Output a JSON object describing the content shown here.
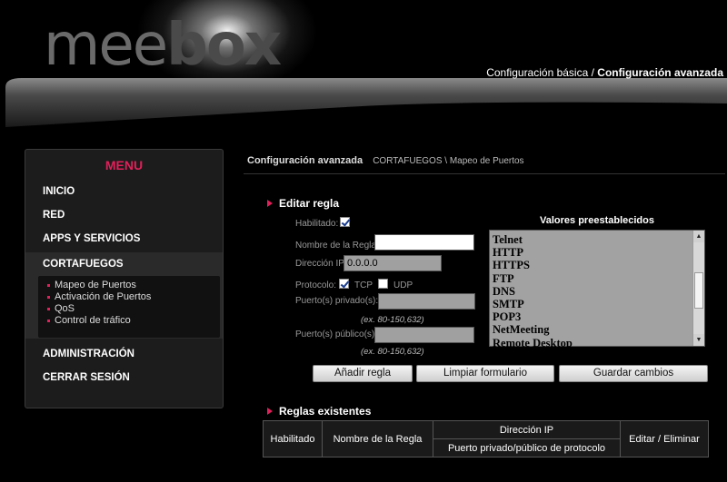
{
  "header": {
    "logo_part1": "mee",
    "logo_part2": "box",
    "nav_basic": "Configuración básica",
    "nav_separator": " / ",
    "nav_advanced": "Configuración avanzada"
  },
  "sidebar": {
    "title": "MENU",
    "items": [
      {
        "label": "INICIO"
      },
      {
        "label": "RED"
      },
      {
        "label": "APPS Y SERVICIOS"
      },
      {
        "label": "CORTAFUEGOS"
      },
      {
        "label": "ADMINISTRACIÓN"
      },
      {
        "label": "CERRAR SESIÓN"
      }
    ],
    "submenu": [
      {
        "label": "Mapeo de Puertos"
      },
      {
        "label": "Activación de Puertos"
      },
      {
        "label": "QoS"
      },
      {
        "label": "Control de tráfico"
      }
    ]
  },
  "breadcrumb": {
    "heading": "Configuración avanzada",
    "path": "CORTAFUEGOS \\ Mapeo de Puertos"
  },
  "edit_rule": {
    "title": "Editar regla",
    "enabled_label": "Habilitado:",
    "enabled_checked": true,
    "rule_name_label": "Nombre de la Regla:",
    "rule_name_value": "",
    "ip_label": "Dirección IP:",
    "ip_value": "0.0.0.0",
    "protocol_label": "Protocolo:",
    "tcp_label": "TCP",
    "tcp_checked": true,
    "udp_label": "UDP",
    "udp_checked": false,
    "private_ports_label": "Puerto(s) privado(s):",
    "private_ports_value": "",
    "private_hint": "(ex. 80-150,632)",
    "public_ports_label": "Puerto(s) público(s):",
    "public_ports_value": "",
    "public_hint": "(ex. 80-150,632)"
  },
  "presets": {
    "title": "Valores preestablecidos",
    "options": [
      "Telnet",
      "HTTP",
      "HTTPS",
      "FTP",
      "DNS",
      "SMTP",
      "POP3",
      "NetMeeting",
      "Remote Desktop"
    ]
  },
  "buttons": {
    "add": "Añadir regla",
    "clear": "Limpiar formulario",
    "save": "Guardar cambios"
  },
  "existing_rules": {
    "title": "Reglas existentes",
    "columns": {
      "enabled": "Habilitado",
      "rule_name": "Nombre de la Regla",
      "ip": "Dirección IP",
      "ports": "Puerto privado/público de protocolo",
      "edit": "Editar / Eliminar"
    }
  },
  "colors": {
    "accent": "#e0205a",
    "background": "#000000",
    "sidebar_bg": "#1c1c1c"
  }
}
